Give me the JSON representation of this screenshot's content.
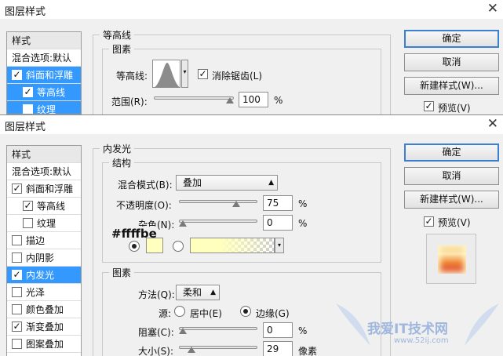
{
  "top_dialog": {
    "title": "图层样式",
    "styles_header": "样式",
    "list_items": [
      {
        "label": "混合选项:默认"
      },
      {
        "label": "斜面和浮雕"
      },
      {
        "label": "等高线"
      },
      {
        "label": "纹理"
      }
    ],
    "section_title": "等高线",
    "group_title": "图素",
    "contour_label": "等高线:",
    "anti_alias_label": "消除锯齿(L)",
    "range_label": "范围(R):",
    "range_value": "100",
    "range_unit": "%",
    "range_level": 100,
    "buttons": {
      "ok": "确定",
      "cancel": "取消",
      "new_style": "新建样式(W)...",
      "preview": "预览(V)"
    }
  },
  "bottom_dialog": {
    "title": "图层样式",
    "styles_header": "样式",
    "list_items": [
      {
        "label": "混合选项:默认"
      },
      {
        "label": "斜面和浮雕"
      },
      {
        "label": "等高线"
      },
      {
        "label": "纹理"
      },
      {
        "label": "描边"
      },
      {
        "label": "内阴影"
      },
      {
        "label": "内发光"
      },
      {
        "label": "光泽"
      },
      {
        "label": "颜色叠加"
      },
      {
        "label": "渐变叠加"
      },
      {
        "label": "图案叠加"
      }
    ],
    "section_title": "内发光",
    "structure": {
      "title": "结构",
      "blend_mode_label": "混合模式(B):",
      "blend_mode_value": "叠加",
      "opacity_label": "不透明度(O):",
      "opacity_value": "75",
      "opacity_level": 75,
      "noise_label": "杂色(N):",
      "noise_value": "0",
      "noise_level": 0,
      "unit": "%",
      "color_hex": "#ffffbe"
    },
    "elements": {
      "title": "图素",
      "method_label": "方法(Q):",
      "method_value": "柔和",
      "source_label": "源:",
      "center_label": "居中(E)",
      "edge_label": "边缘(G)",
      "choke_label": "阻塞(C):",
      "choke_value": "0",
      "choke_unit": "%",
      "choke_level": 0,
      "size_label": "大小(S):",
      "size_value": "29",
      "size_unit": "像素",
      "size_level": 12
    },
    "buttons": {
      "ok": "确定",
      "cancel": "取消",
      "new_style": "新建样式(W)...",
      "preview": "预览(V)"
    }
  },
  "watermark": {
    "text": "我爱IT技术网",
    "url": "www.52ij.com"
  },
  "colors": {
    "selection": "#3399ff",
    "glow": "#ffffbe"
  }
}
